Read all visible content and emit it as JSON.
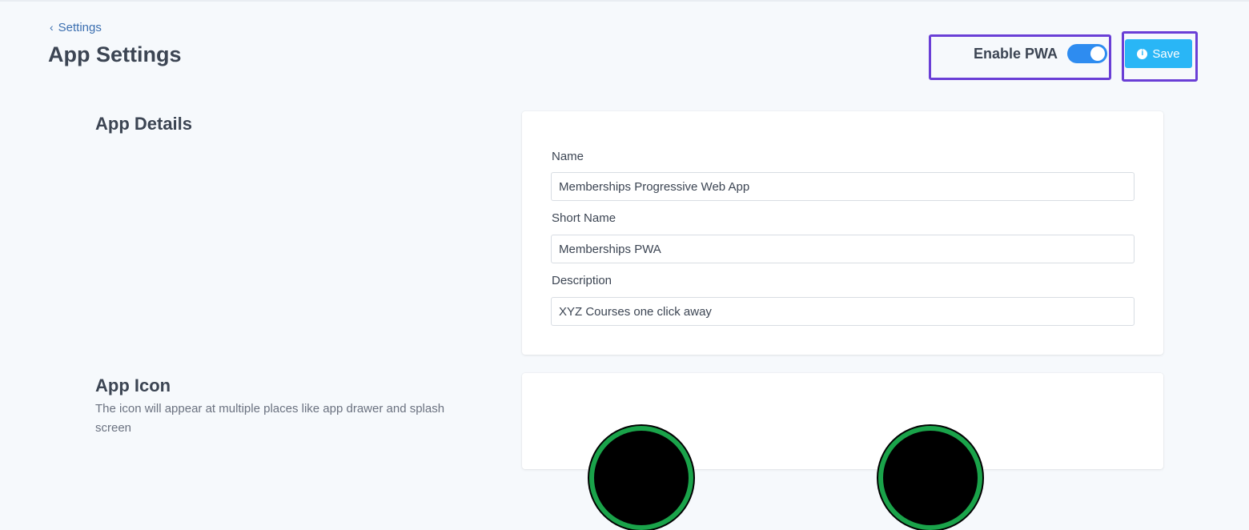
{
  "header": {
    "back_label": "Settings",
    "title": "App Settings"
  },
  "pwa": {
    "label": "Enable PWA",
    "enabled": true
  },
  "save": {
    "label": "Save",
    "icon": "info-icon"
  },
  "details": {
    "title": "App Details",
    "fields": [
      {
        "label": "Name",
        "value": "Memberships Progressive Web App"
      },
      {
        "label": "Short Name",
        "value": "Memberships PWA"
      },
      {
        "label": "Description",
        "value": "XYZ Courses one click away"
      }
    ]
  },
  "icon_section": {
    "title": "App Icon",
    "description": "The icon will appear at multiple places like app drawer and splash screen"
  },
  "colors": {
    "accent": "#29b6f6",
    "toggle_on": "#2e8cf0",
    "highlight": "#6a3fd6",
    "icon_ring": "#1aa34a"
  }
}
